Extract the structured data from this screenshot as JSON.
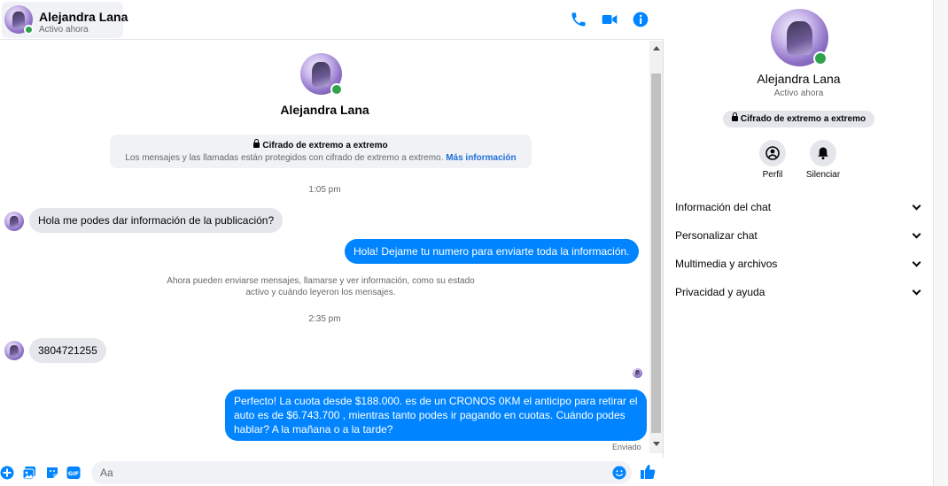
{
  "contact": {
    "name": "Alejandra Lana",
    "status": "Activo ahora"
  },
  "header_icons": [
    "phone-icon",
    "video-camera-icon",
    "info-icon"
  ],
  "intro": {
    "name": "Alejandra Lana",
    "e2e_title": "Cifrado de extremo a extremo",
    "e2e_body": "Los mensajes y las llamadas están protegidos con cifrado de extremo a extremo.",
    "e2e_link": "Más información"
  },
  "messages": {
    "time1": "1:05 pm",
    "m1": "Hola me podes dar información de la publicación?",
    "m2": "Hola! Dejame tu numero  para enviarte toda la información.",
    "system_line1": "Ahora pueden enviarse mensajes, llamarse y ver información, como su estado",
    "system_line2": "activo y cuándo leyeron los mensajes.",
    "time2": "2:35 pm",
    "m3": "3804721255",
    "m4_line1": "Perfecto! La cuota desde $188.000. es de un CRONOS 0KM el anticipo para retirar el",
    "m4_line2": "auto es de $6.743.700 , mientras tanto podes ir pagando en cuotas. Cuándo podes",
    "m4_line3": "hablar? A la mañana o a la tarde?",
    "sent_status": "Enviado"
  },
  "composer": {
    "placeholder": "Aa"
  },
  "info_panel": {
    "name": "Alejandra Lana",
    "status": "Activo ahora",
    "e2e_badge": "Cifrado de extremo a extremo",
    "profile_label": "Perfil",
    "mute_label": "Silenciar",
    "sections": [
      "Información del chat",
      "Personalizar chat",
      "Multimedia y archivos",
      "Privacidad y ayuda"
    ]
  },
  "colors": {
    "accent": "#0084ff",
    "online": "#31a24c",
    "incoming_bubble": "#e4e6eb",
    "link": "#216fdb"
  }
}
